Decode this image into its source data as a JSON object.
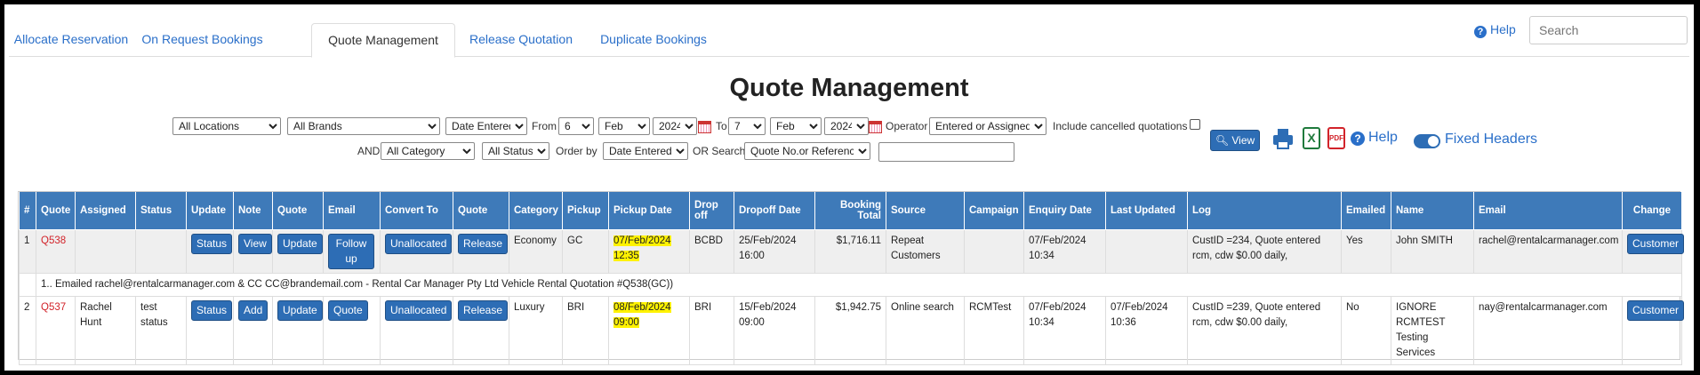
{
  "tabs": [
    "Allocate Reservation",
    "On Request Bookings",
    "Quote Management",
    "Release Quotation",
    "Duplicate Bookings"
  ],
  "active_tab": "Quote Management",
  "help_label": "Help",
  "search_placeholder": "Search",
  "page_title": "Quote Management",
  "filters": {
    "location": "All Locations",
    "brand": "All Brands",
    "date_type": "Date Entered",
    "from_label": "From",
    "from_day": "6",
    "from_month": "Feb",
    "from_year": "2024",
    "to_label": "To",
    "to_day": "7",
    "to_month": "Feb",
    "to_year": "2024",
    "operator_label": "Operator",
    "operator": "Entered or Assigned",
    "include_cancelled_label": "Include cancelled quotations",
    "and_label": "AND",
    "category": "All Category",
    "status": "All Status",
    "order_by_label": "Order by",
    "order_by": "Date Entered",
    "or_search_label": "OR Search",
    "search_field": "Quote No.or Reference",
    "search_value": ""
  },
  "toolbar": {
    "view_label": "View",
    "help_label": "Help",
    "fixed_headers_label": "Fixed Headers",
    "xls_label": "X",
    "pdf_label": "PDF"
  },
  "table": {
    "headers": [
      "#",
      "Quote",
      "Assigned",
      "Status",
      "Update",
      "Note",
      "Quote",
      "Email",
      "Convert To",
      "Quote",
      "Category",
      "Pickup",
      "Pickup Date",
      "Drop off",
      "Dropoff Date",
      "Booking Total",
      "Source",
      "Campaign",
      "Enquiry Date",
      "Last Updated",
      "Log",
      "Emailed",
      "Name",
      "Email",
      "Change"
    ],
    "rows": [
      {
        "num": "1",
        "quote": "Q538",
        "assigned": "",
        "status": "",
        "update_btn": "Status",
        "note_btn": "View",
        "quote_btn": "Update",
        "email_btn": "Follow up",
        "convert_btn": "Unallocated",
        "release_btn": "Release",
        "category": "Economy",
        "pickup": "GC",
        "pickup_date": "07/Feb/2024",
        "pickup_time": "12:35",
        "dropoff": "BCBD",
        "dropoff_date": "25/Feb/2024",
        "dropoff_time": "16:00",
        "total": "$1,716.11",
        "source": "Repeat Customers",
        "campaign": "",
        "enquiry_date": "07/Feb/2024",
        "enquiry_time": "10:34",
        "last_updated": "",
        "log": "CustID =234, Quote entered rcm, cdw $0.00 daily,",
        "emailed": "Yes",
        "name": "John SMITH",
        "email": "rachel@rentalcarmanager.com",
        "change_btn": "Customer"
      },
      {
        "num": "2",
        "quote": "Q537",
        "assigned": "Rachel Hunt",
        "status": "test status",
        "update_btn": "Status",
        "note_btn": "Add",
        "quote_btn": "Update",
        "email_btn": "Quote",
        "convert_btn": "Unallocated",
        "release_btn": "Release",
        "category": "Luxury",
        "pickup": "BRI",
        "pickup_date": "08/Feb/2024",
        "pickup_time": "09:00",
        "dropoff": "BRI",
        "dropoff_date": "15/Feb/2024",
        "dropoff_time": "09:00",
        "total": "$1,942.75",
        "source": "Online search",
        "campaign": "RCMTest",
        "enquiry_date": "07/Feb/2024",
        "enquiry_time": "10:34",
        "last_updated": "07/Feb/2024 10:36",
        "log": "CustID =239, Quote entered rcm, cdw $0.00 daily,",
        "emailed": "No",
        "name": "IGNORE RCMTEST Testing Services",
        "email": "nay@rentalcarmanager.com",
        "change_btn": "Customer"
      }
    ],
    "note_row1": "1.. Emailed rachel@rentalcarmanager.com & CC CC@brandemail.com - Rental Car Manager Pty Ltd Vehicle Rental Quotation #Q538(GC))"
  },
  "colors": {
    "header_blue": "#3e7ab9",
    "button_blue": "#2d6db5",
    "link_blue": "#2a6fc9",
    "quote_red": "#d2232a",
    "highlight_yellow": "#fff200"
  }
}
